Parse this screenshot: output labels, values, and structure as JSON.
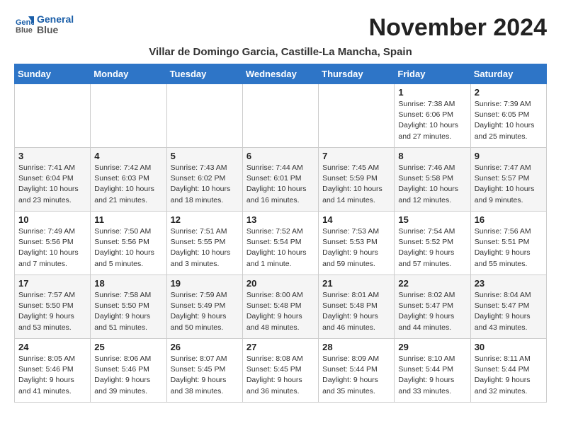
{
  "header": {
    "logo_line1": "General",
    "logo_line2": "Blue",
    "month_year": "November 2024",
    "location": "Villar de Domingo Garcia, Castille-La Mancha, Spain"
  },
  "weekdays": [
    "Sunday",
    "Monday",
    "Tuesday",
    "Wednesday",
    "Thursday",
    "Friday",
    "Saturday"
  ],
  "weeks": [
    [
      {
        "day": "",
        "info": ""
      },
      {
        "day": "",
        "info": ""
      },
      {
        "day": "",
        "info": ""
      },
      {
        "day": "",
        "info": ""
      },
      {
        "day": "",
        "info": ""
      },
      {
        "day": "1",
        "info": "Sunrise: 7:38 AM\nSunset: 6:06 PM\nDaylight: 10 hours and 27 minutes."
      },
      {
        "day": "2",
        "info": "Sunrise: 7:39 AM\nSunset: 6:05 PM\nDaylight: 10 hours and 25 minutes."
      }
    ],
    [
      {
        "day": "3",
        "info": "Sunrise: 7:41 AM\nSunset: 6:04 PM\nDaylight: 10 hours and 23 minutes."
      },
      {
        "day": "4",
        "info": "Sunrise: 7:42 AM\nSunset: 6:03 PM\nDaylight: 10 hours and 21 minutes."
      },
      {
        "day": "5",
        "info": "Sunrise: 7:43 AM\nSunset: 6:02 PM\nDaylight: 10 hours and 18 minutes."
      },
      {
        "day": "6",
        "info": "Sunrise: 7:44 AM\nSunset: 6:01 PM\nDaylight: 10 hours and 16 minutes."
      },
      {
        "day": "7",
        "info": "Sunrise: 7:45 AM\nSunset: 5:59 PM\nDaylight: 10 hours and 14 minutes."
      },
      {
        "day": "8",
        "info": "Sunrise: 7:46 AM\nSunset: 5:58 PM\nDaylight: 10 hours and 12 minutes."
      },
      {
        "day": "9",
        "info": "Sunrise: 7:47 AM\nSunset: 5:57 PM\nDaylight: 10 hours and 9 minutes."
      }
    ],
    [
      {
        "day": "10",
        "info": "Sunrise: 7:49 AM\nSunset: 5:56 PM\nDaylight: 10 hours and 7 minutes."
      },
      {
        "day": "11",
        "info": "Sunrise: 7:50 AM\nSunset: 5:56 PM\nDaylight: 10 hours and 5 minutes."
      },
      {
        "day": "12",
        "info": "Sunrise: 7:51 AM\nSunset: 5:55 PM\nDaylight: 10 hours and 3 minutes."
      },
      {
        "day": "13",
        "info": "Sunrise: 7:52 AM\nSunset: 5:54 PM\nDaylight: 10 hours and 1 minute."
      },
      {
        "day": "14",
        "info": "Sunrise: 7:53 AM\nSunset: 5:53 PM\nDaylight: 9 hours and 59 minutes."
      },
      {
        "day": "15",
        "info": "Sunrise: 7:54 AM\nSunset: 5:52 PM\nDaylight: 9 hours and 57 minutes."
      },
      {
        "day": "16",
        "info": "Sunrise: 7:56 AM\nSunset: 5:51 PM\nDaylight: 9 hours and 55 minutes."
      }
    ],
    [
      {
        "day": "17",
        "info": "Sunrise: 7:57 AM\nSunset: 5:50 PM\nDaylight: 9 hours and 53 minutes."
      },
      {
        "day": "18",
        "info": "Sunrise: 7:58 AM\nSunset: 5:50 PM\nDaylight: 9 hours and 51 minutes."
      },
      {
        "day": "19",
        "info": "Sunrise: 7:59 AM\nSunset: 5:49 PM\nDaylight: 9 hours and 50 minutes."
      },
      {
        "day": "20",
        "info": "Sunrise: 8:00 AM\nSunset: 5:48 PM\nDaylight: 9 hours and 48 minutes."
      },
      {
        "day": "21",
        "info": "Sunrise: 8:01 AM\nSunset: 5:48 PM\nDaylight: 9 hours and 46 minutes."
      },
      {
        "day": "22",
        "info": "Sunrise: 8:02 AM\nSunset: 5:47 PM\nDaylight: 9 hours and 44 minutes."
      },
      {
        "day": "23",
        "info": "Sunrise: 8:04 AM\nSunset: 5:47 PM\nDaylight: 9 hours and 43 minutes."
      }
    ],
    [
      {
        "day": "24",
        "info": "Sunrise: 8:05 AM\nSunset: 5:46 PM\nDaylight: 9 hours and 41 minutes."
      },
      {
        "day": "25",
        "info": "Sunrise: 8:06 AM\nSunset: 5:46 PM\nDaylight: 9 hours and 39 minutes."
      },
      {
        "day": "26",
        "info": "Sunrise: 8:07 AM\nSunset: 5:45 PM\nDaylight: 9 hours and 38 minutes."
      },
      {
        "day": "27",
        "info": "Sunrise: 8:08 AM\nSunset: 5:45 PM\nDaylight: 9 hours and 36 minutes."
      },
      {
        "day": "28",
        "info": "Sunrise: 8:09 AM\nSunset: 5:44 PM\nDaylight: 9 hours and 35 minutes."
      },
      {
        "day": "29",
        "info": "Sunrise: 8:10 AM\nSunset: 5:44 PM\nDaylight: 9 hours and 33 minutes."
      },
      {
        "day": "30",
        "info": "Sunrise: 8:11 AM\nSunset: 5:44 PM\nDaylight: 9 hours and 32 minutes."
      }
    ]
  ]
}
